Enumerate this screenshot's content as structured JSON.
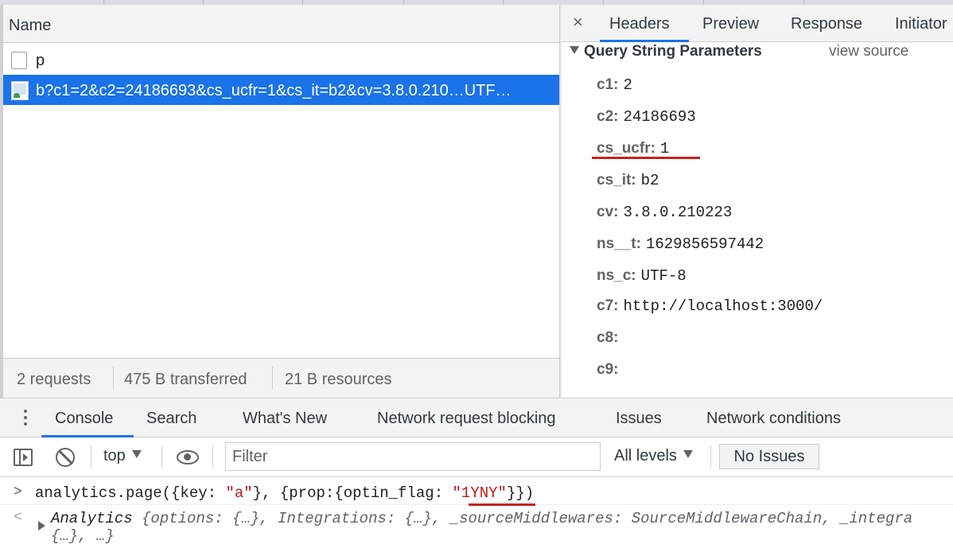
{
  "network_list": {
    "name_header": "Name",
    "rows": [
      {
        "label": "p"
      },
      {
        "label": "b?c1=2&c2=24186693&cs_ucfr=1&cs_it=b2&cv=3.8.0.210…UTF…"
      }
    ],
    "status": {
      "requests": "2 requests",
      "transferred": "475 B transferred",
      "resources": "21 B resources"
    }
  },
  "details": {
    "close_label": "×",
    "tabs": [
      "Headers",
      "Preview",
      "Response",
      "Initiator"
    ],
    "active_tab": "Headers",
    "section_title": "Query String Parameters",
    "view_source": "view source",
    "params": [
      {
        "key": "c1:",
        "value": "2"
      },
      {
        "key": "c2:",
        "value": "24186693"
      },
      {
        "key": "cs_ucfr:",
        "value": "1"
      },
      {
        "key": "cs_it:",
        "value": "b2"
      },
      {
        "key": "cv:",
        "value": "3.8.0.210223"
      },
      {
        "key": "ns__t:",
        "value": "1629856597442"
      },
      {
        "key": "ns_c:",
        "value": "UTF-8"
      },
      {
        "key": "c7:",
        "value": "http://localhost:3000/"
      },
      {
        "key": "c8:",
        "value": ""
      },
      {
        "key": "c9:",
        "value": ""
      }
    ]
  },
  "drawer": {
    "tabs": [
      "Console",
      "Search",
      "What's New",
      "Network request blocking",
      "Issues",
      "Network conditions"
    ],
    "active_tab": "Console"
  },
  "toolbar": {
    "context": "top",
    "filter_placeholder": "Filter",
    "levels": "All levels",
    "no_issues": "No Issues"
  },
  "console": {
    "cmd_prefix": "analytics.page({key: ",
    "cmd_str1": "\"a\"",
    "cmd_mid": "}, {prop:{optin_flag: ",
    "cmd_str2": "\"1YNY\"",
    "cmd_suffix": "}})",
    "result_class": "Analytics ",
    "result_line1": "{options: {…}, Integrations: {…}, _sourceMiddlewares: SourceMiddlewareChain, _integra",
    "result_line2": "{…}, …}"
  },
  "colors": {
    "accent": "#1a73e8",
    "selected_row": "#1a73e8",
    "annotation_red": "#c5221f",
    "string_red": "#c41a16"
  }
}
